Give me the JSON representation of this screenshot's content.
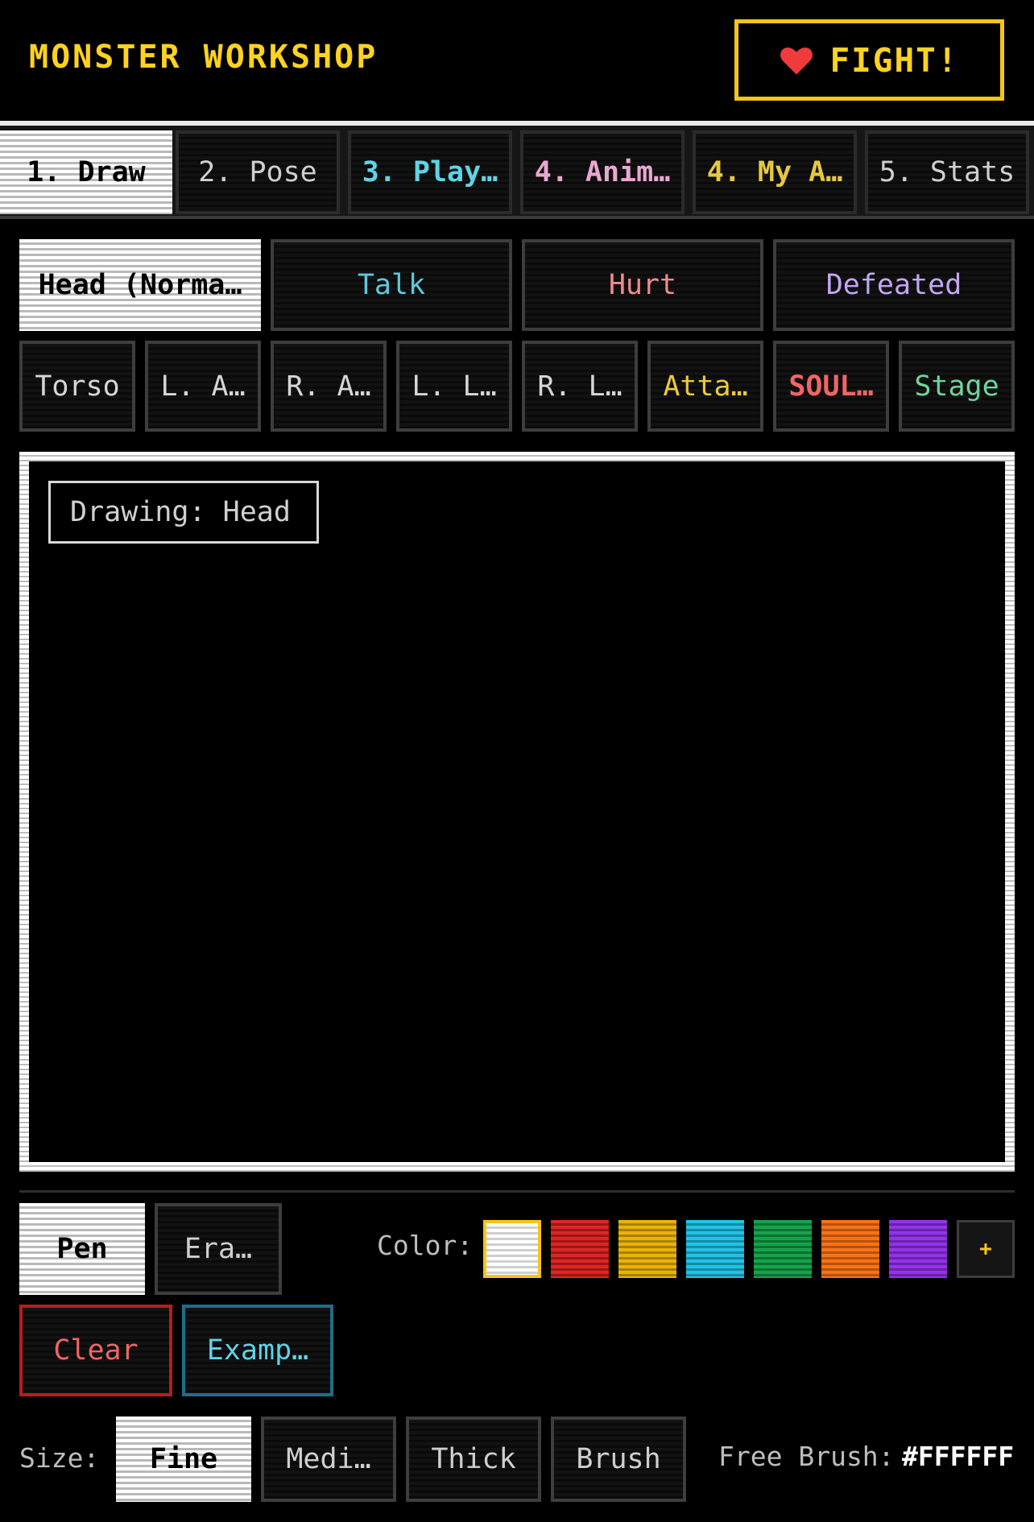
{
  "header": {
    "title": "MONSTER WORKSHOP",
    "fight_label": "FIGHT!"
  },
  "tabs": [
    {
      "label": "1. Draw",
      "active": true,
      "color": "#000000"
    },
    {
      "label": "2. Pose",
      "active": false,
      "color": "#cfcfcf"
    },
    {
      "label": "3. Play…",
      "active": false,
      "color": "#5fd3e6"
    },
    {
      "label": "4. Anim…",
      "active": false,
      "color": "#e9a7d2"
    },
    {
      "label": "4. My A…",
      "active": false,
      "color": "#e6c840"
    },
    {
      "label": "5. Stats",
      "active": false,
      "color": "#cfcfcf"
    }
  ],
  "states": [
    {
      "label": "Head (Norma…",
      "active": true,
      "color": "#000000"
    },
    {
      "label": "Talk",
      "active": false,
      "color": "#5fc8dc"
    },
    {
      "label": "Hurt",
      "active": false,
      "color": "#f08c8c"
    },
    {
      "label": "Defeated",
      "active": false,
      "color": "#c3a6f2"
    }
  ],
  "parts": [
    {
      "label": "Torso",
      "color": "#d6d6d6"
    },
    {
      "label": "L. A…",
      "color": "#d6d6d6"
    },
    {
      "label": "R. A…",
      "color": "#d6d6d6"
    },
    {
      "label": "L. L…",
      "color": "#d6d6d6"
    },
    {
      "label": "R. L…",
      "color": "#d6d6d6"
    },
    {
      "label": "Atta…",
      "color": "#ecc93a"
    },
    {
      "label": "SOUL…",
      "color": "#f06565"
    },
    {
      "label": "Stage",
      "color": "#6fd49c"
    }
  ],
  "canvas": {
    "drawing_label": "Drawing: Head"
  },
  "tools": {
    "pen": "Pen",
    "eraser": "Era…",
    "clear": "Clear",
    "examples": "Examp…"
  },
  "color_picker": {
    "label": "Color:",
    "swatches": [
      "#ffffff",
      "#dc2626",
      "#eab308",
      "#22c3e6",
      "#16a34a",
      "#f97316",
      "#9333ea"
    ],
    "selected": "#ffffff",
    "add_label": "+"
  },
  "sizes": {
    "label": "Size:",
    "options": [
      "Fine",
      "Medi…",
      "Thick",
      "Brush"
    ],
    "selected": "Fine"
  },
  "free_brush": {
    "label": "Free Brush:",
    "value": "#FFFFFF"
  }
}
